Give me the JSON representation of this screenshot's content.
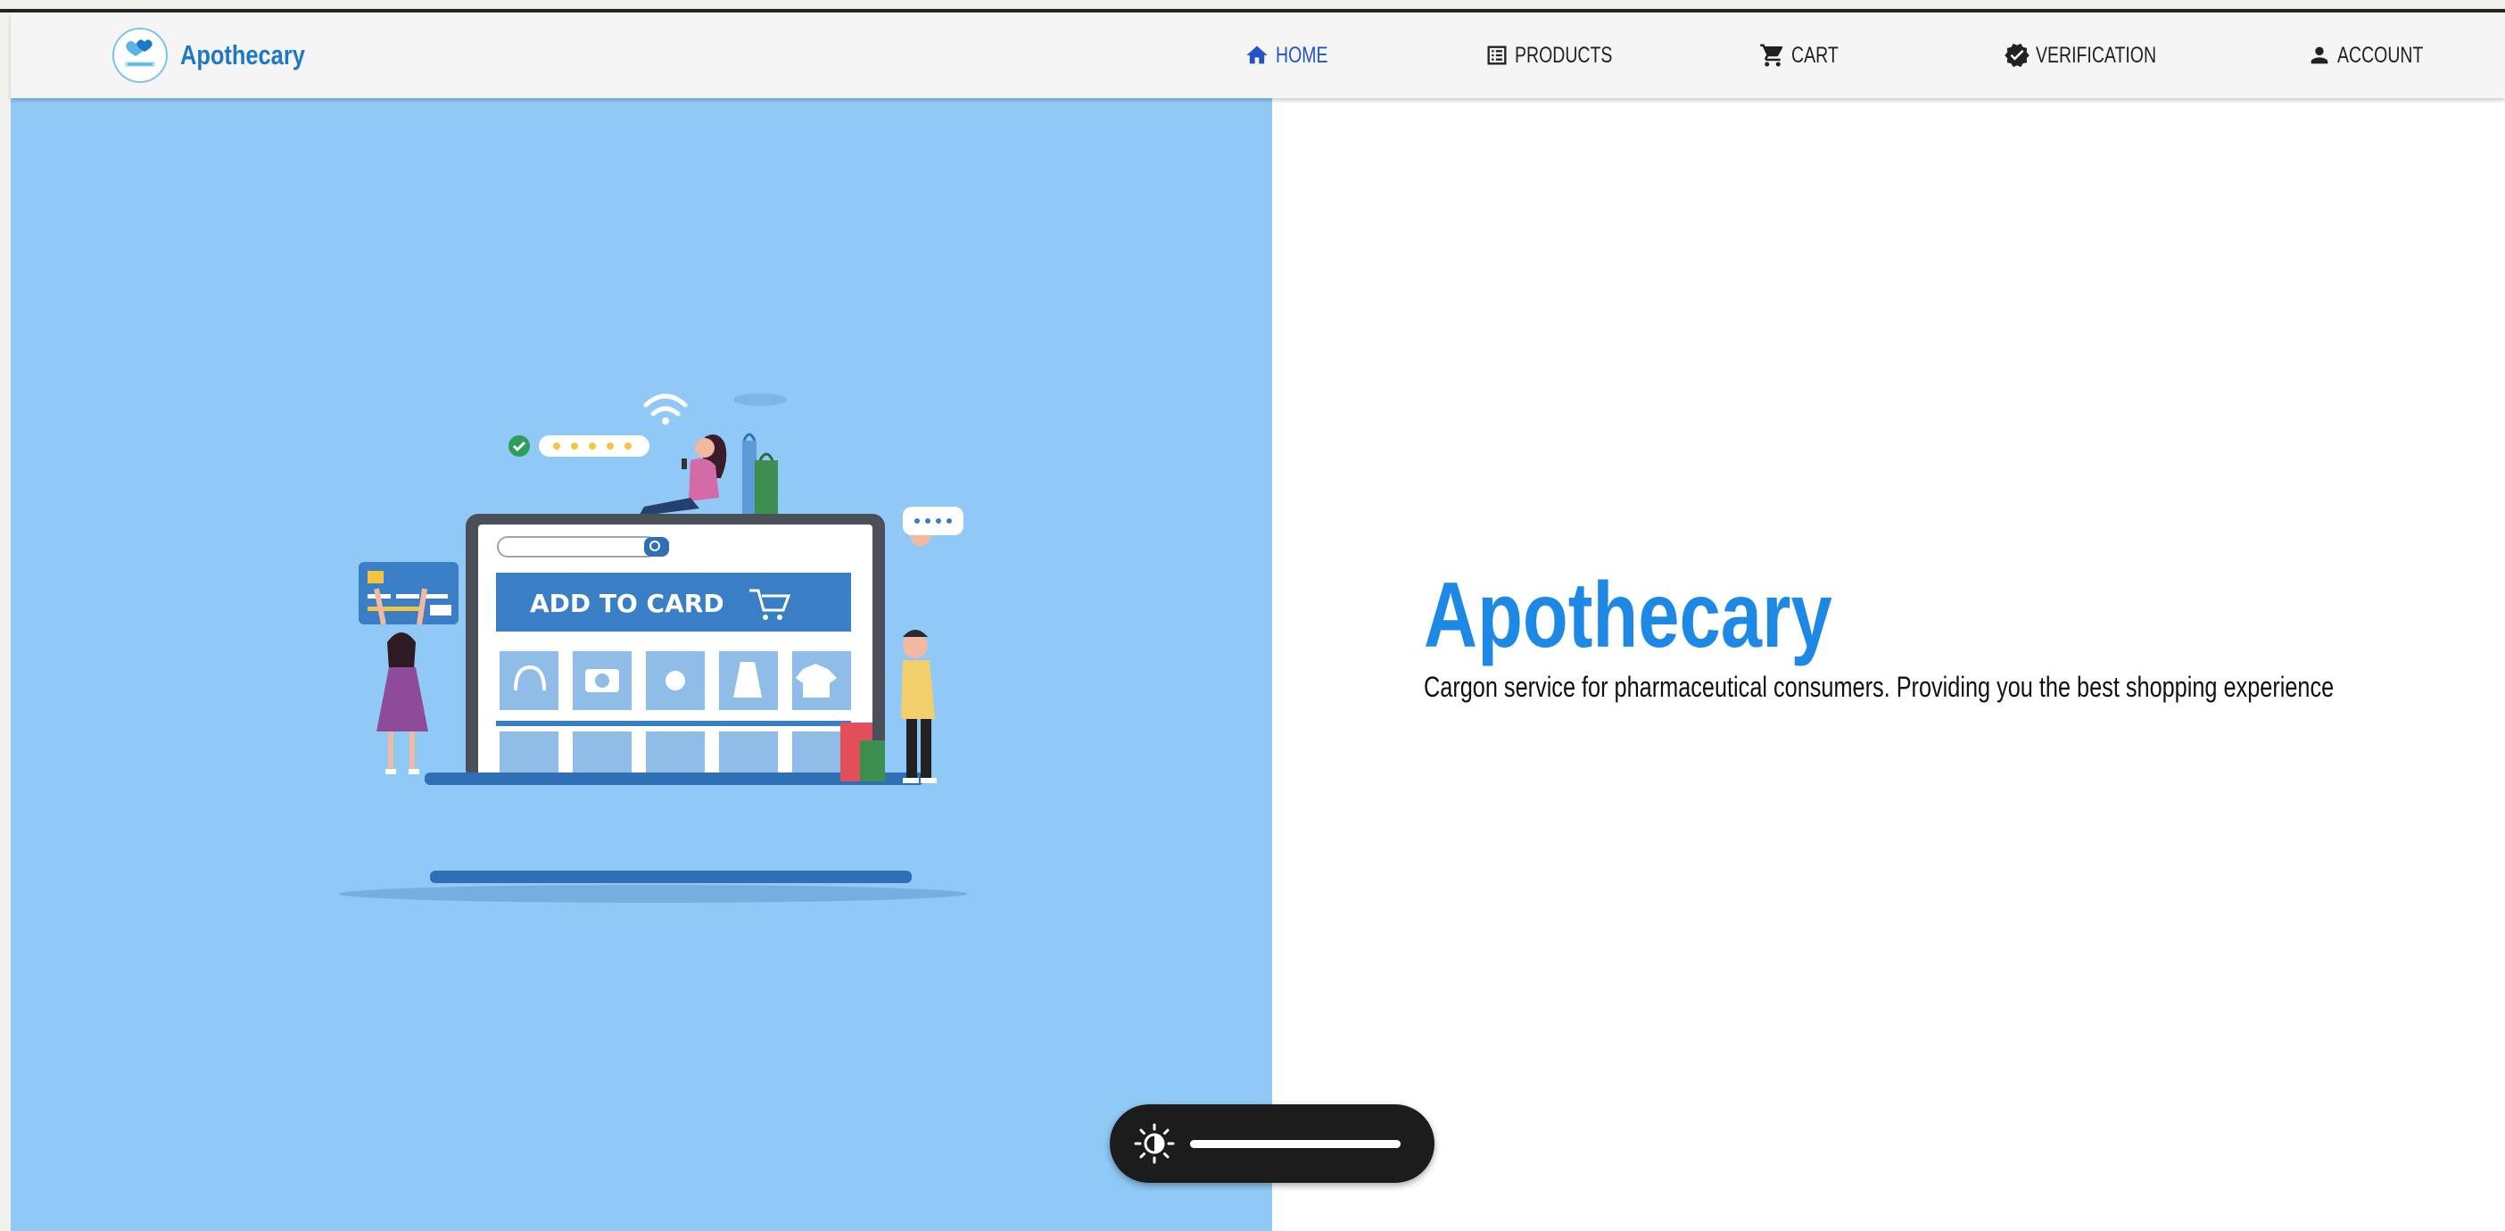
{
  "app": {
    "brand_name": "Apothecary"
  },
  "nav": {
    "items": [
      {
        "label": "HOME",
        "icon": "home-icon",
        "active": true
      },
      {
        "label": "PRODUCTS",
        "icon": "list-icon",
        "active": false
      },
      {
        "label": "CART",
        "icon": "cart-icon",
        "active": false
      },
      {
        "label": "VERIFICATION",
        "icon": "verified-badge-icon",
        "active": false
      },
      {
        "label": "ACCOUNT",
        "icon": "person-icon",
        "active": false
      }
    ]
  },
  "hero": {
    "title": "Apothecary",
    "subtitle": "Cargon service for pharmaceutical consumers. Providing you the best shopping experience",
    "illustration": {
      "banner_text": "ADD TO CARD"
    }
  },
  "brightness": {
    "icon": "brightness-contrast-icon",
    "level": 1.0
  },
  "colors": {
    "accent": "#1e88e5",
    "nav_active": "#2453c8",
    "hero_left_bg": "#90c9f6",
    "navbar_bg": "#f5f5f5",
    "pill_bg": "#1c1c1c"
  }
}
